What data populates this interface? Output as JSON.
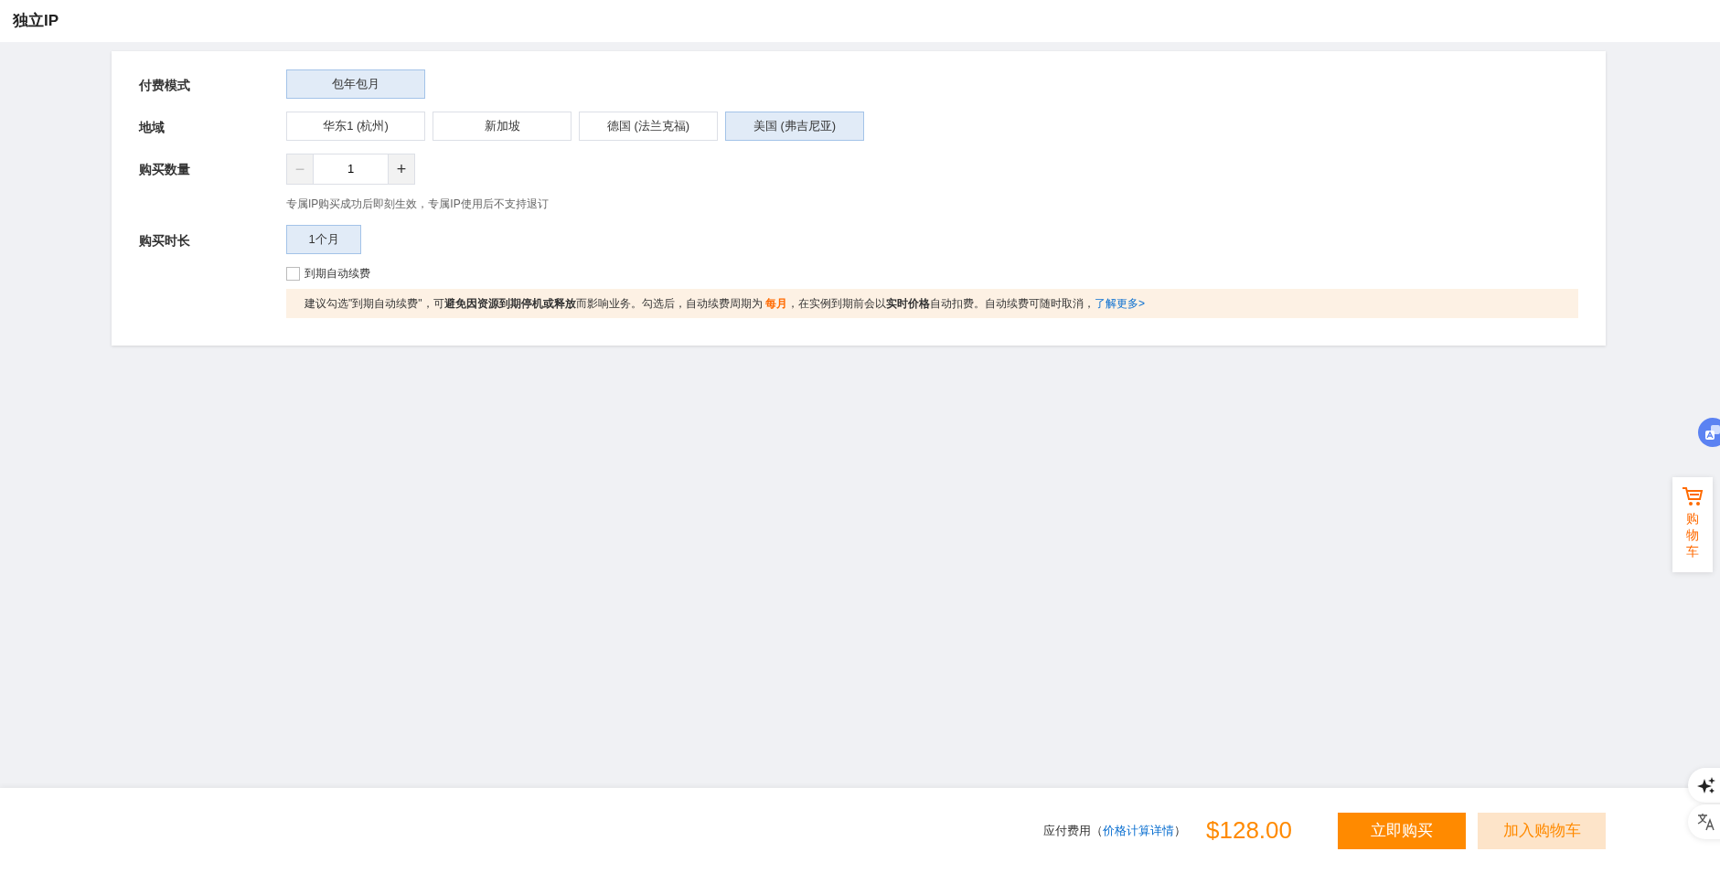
{
  "page_title": "独立IP",
  "form": {
    "rows": [
      {
        "kind": "options",
        "label": "付费模式",
        "options": [
          {
            "label": "包年包月",
            "selected": true
          }
        ]
      },
      {
        "kind": "options",
        "label": "地域",
        "options": [
          {
            "label": "华东1 (杭州)",
            "selected": false
          },
          {
            "label": "新加坡",
            "selected": false
          },
          {
            "label": "德国 (法兰克福)",
            "selected": false
          },
          {
            "label": "美国 (弗吉尼亚)",
            "selected": true
          }
        ]
      },
      {
        "kind": "stepper",
        "label": "购买数量",
        "value": "1",
        "minus": "−",
        "plus": "+",
        "minus_disabled": true,
        "hint": "专属IP购买成功后即刻生效，专属IP使用后不支持退订"
      },
      {
        "kind": "options",
        "label": "购买时长",
        "options": [
          {
            "label": "1个月",
            "selected": true
          }
        ]
      }
    ],
    "auto_renew": {
      "label": "到期自动续费",
      "checked": false
    },
    "notice": {
      "before": "建议勾选\"到期自动续费\"，可**避免因资源到期停机或释放**而影响业务。勾选后，自动续费周期为 ",
      "highlight": "每月",
      "after": "，在实例到期前会以**实时价格**自动扣费。自动续费可随时取消，",
      "link": "了解更多>"
    }
  },
  "cart_panel": {
    "label": "购物车"
  },
  "footer": {
    "fee_label": "应付费用",
    "paren_open": "（",
    "detail_link": "价格计算详情",
    "paren_close": "）",
    "price": "$128.00",
    "buy_button": "立即购买",
    "cart_button": "加入购物车"
  }
}
